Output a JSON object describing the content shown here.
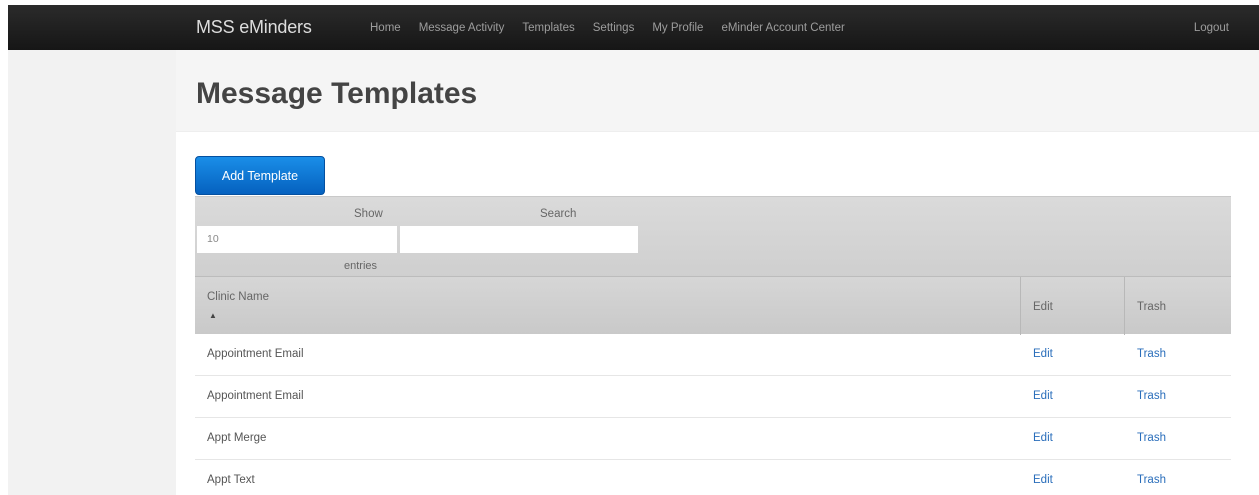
{
  "navbar": {
    "brand": "MSS eMinders",
    "links": [
      "Home",
      "Message Activity",
      "Templates",
      "Settings",
      "My Profile",
      "eMinder Account Center"
    ],
    "logout": "Logout"
  },
  "page": {
    "title": "Message Templates",
    "add_button": "Add Template"
  },
  "toolbar": {
    "show_label": "Show",
    "length_value": "10",
    "entries_label": "entries",
    "search_label": "Search",
    "search_value": ""
  },
  "table": {
    "columns": {
      "name": "Clinic Name",
      "edit": "Edit",
      "trash": "Trash"
    },
    "sort_indicator": "▲",
    "rows": [
      {
        "name": "Appointment Email",
        "edit": "Edit",
        "trash": "Trash"
      },
      {
        "name": "Appointment Email",
        "edit": "Edit",
        "trash": "Trash"
      },
      {
        "name": "Appt Merge",
        "edit": "Edit",
        "trash": "Trash"
      },
      {
        "name": "Appt Text",
        "edit": "Edit",
        "trash": "Trash"
      }
    ]
  },
  "colors": {
    "navbar_bg": "#1f1f1f",
    "primary_button": "#0e78d5",
    "link": "#2a6ebb"
  }
}
